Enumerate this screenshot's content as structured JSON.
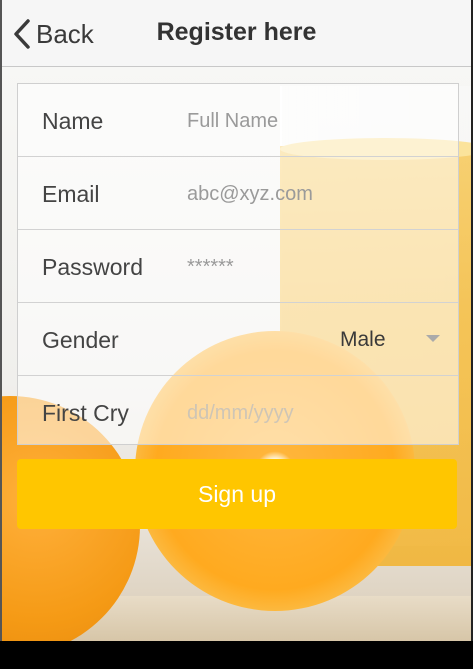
{
  "header": {
    "back_label": "Back",
    "title": "Register here"
  },
  "form": {
    "name": {
      "label": "Name",
      "placeholder": "Full Name",
      "value": ""
    },
    "email": {
      "label": "Email",
      "placeholder": "abc@xyz.com",
      "value": ""
    },
    "password": {
      "label": "Password",
      "placeholder": "******",
      "value": ""
    },
    "gender": {
      "label": "Gender",
      "selected": "Male"
    },
    "first_cry": {
      "label": "First Cry",
      "placeholder": "dd/mm/yyyy",
      "value": ""
    }
  },
  "signup_label": "Sign up",
  "colors": {
    "accent": "#ffc600",
    "header_bg": "#f6f6f6"
  },
  "icons": {
    "back": "chevron-left-icon",
    "select": "caret-down-icon"
  }
}
